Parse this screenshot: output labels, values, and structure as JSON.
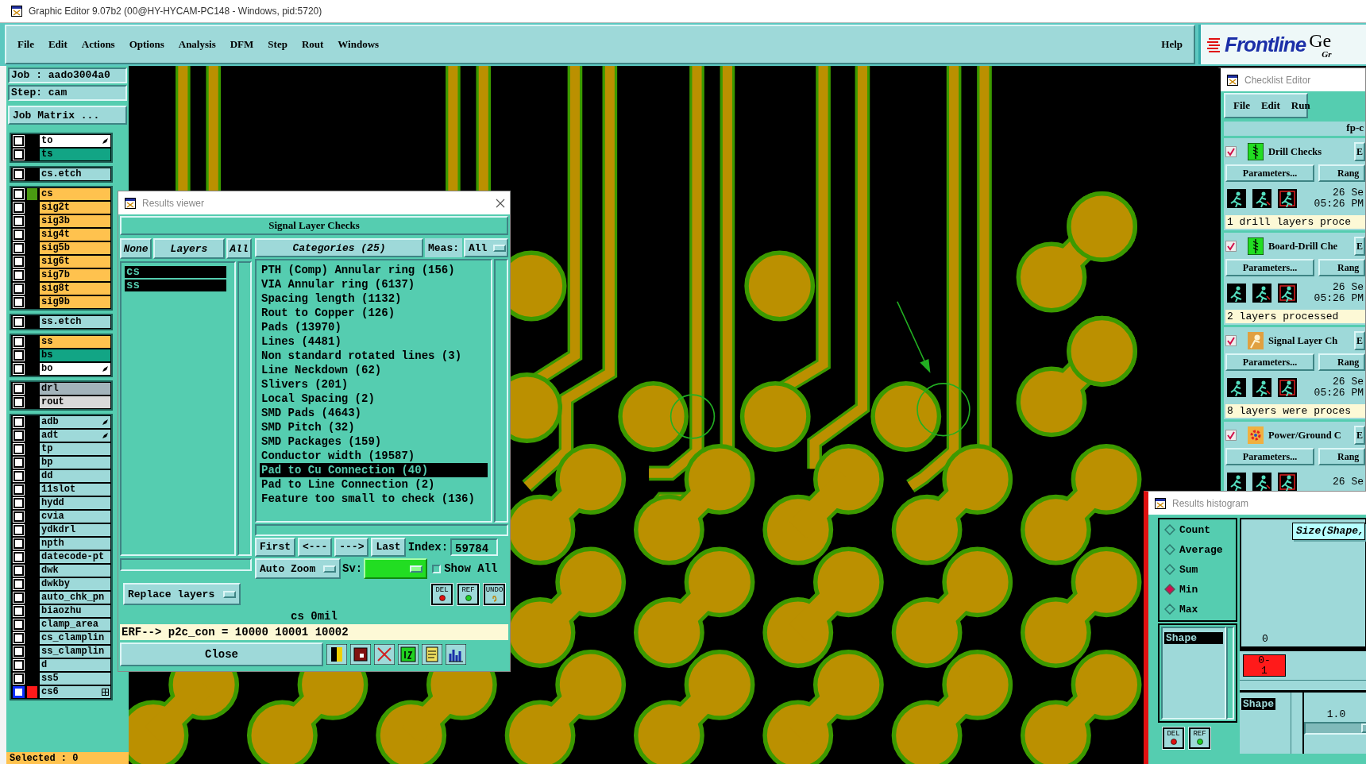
{
  "window": {
    "title": "Graphic Editor 9.07b2 (00@HY-HYCAM-PC148 - Windows, pid:5720)"
  },
  "menu": [
    "File",
    "Edit",
    "Actions",
    "Options",
    "Analysis",
    "DFM",
    "Step",
    "Rout",
    "Windows"
  ],
  "help": "Help",
  "logo": {
    "brand": "Frontline",
    "text": "Ge",
    "subtext": "Gr"
  },
  "job": {
    "job": "Job : aado3004a0",
    "step": "Step: cam",
    "matrix_button": "Job Matrix ..."
  },
  "layer_groups": [
    {
      "layers": [
        {
          "name": "to",
          "color": "#ffffff",
          "kind": "edit",
          "checked": false,
          "work": false,
          "focused": false
        },
        {
          "name": "ts",
          "color": "#12a585",
          "kind": "plain",
          "checked": false,
          "work": false,
          "focused": false
        }
      ]
    },
    {
      "layers": [
        {
          "name": "cs.etch",
          "color": "#9ed9d9",
          "kind": "plain",
          "checked": false,
          "work": false,
          "focused": false
        }
      ]
    },
    {
      "layers": [
        {
          "name": "cs",
          "color": "#ffc24e",
          "kind": "plain",
          "checked": false,
          "work": true,
          "focused": false
        },
        {
          "name": "sig2t",
          "color": "#ffc24e",
          "kind": "plain",
          "checked": false,
          "work": false,
          "focused": false
        },
        {
          "name": "sig3b",
          "color": "#ffc24e",
          "kind": "plain",
          "checked": false,
          "work": false,
          "focused": false
        },
        {
          "name": "sig4t",
          "color": "#ffc24e",
          "kind": "plain",
          "checked": false,
          "work": false,
          "focused": false
        },
        {
          "name": "sig5b",
          "color": "#ffc24e",
          "kind": "plain",
          "checked": false,
          "work": false,
          "focused": false
        },
        {
          "name": "sig6t",
          "color": "#ffc24e",
          "kind": "plain",
          "checked": false,
          "work": false,
          "focused": false
        },
        {
          "name": "sig7b",
          "color": "#ffc24e",
          "kind": "plain",
          "checked": false,
          "work": false,
          "focused": false
        },
        {
          "name": "sig8t",
          "color": "#ffc24e",
          "kind": "plain",
          "checked": false,
          "work": false,
          "focused": false
        },
        {
          "name": "sig9b",
          "color": "#ffc24e",
          "kind": "plain",
          "checked": false,
          "work": false,
          "focused": false
        }
      ]
    },
    {
      "layers": [
        {
          "name": "ss.etch",
          "color": "#9ed9d9",
          "kind": "plain",
          "checked": false,
          "work": false,
          "focused": false
        }
      ]
    },
    {
      "layers": [
        {
          "name": "ss",
          "color": "#ffc24e",
          "kind": "plain",
          "checked": false,
          "work": false,
          "focused": false
        },
        {
          "name": "bs",
          "color": "#12a585",
          "kind": "plain",
          "checked": false,
          "work": false,
          "focused": false
        },
        {
          "name": "bo",
          "color": "#ffffff",
          "kind": "edit",
          "checked": false,
          "work": false,
          "focused": false
        }
      ]
    },
    {
      "layers": [
        {
          "name": "drl",
          "color": "#a3b3bb",
          "kind": "plain",
          "checked": false,
          "work": false,
          "focused": false
        },
        {
          "name": "rout",
          "color": "#dadada",
          "kind": "plain",
          "checked": false,
          "work": false,
          "focused": false
        }
      ]
    },
    {
      "layers": [
        {
          "name": "adb",
          "color": "#9ed9d9",
          "kind": "edit",
          "checked": false,
          "work": false,
          "focused": false
        },
        {
          "name": "adt",
          "color": "#9ed9d9",
          "kind": "edit",
          "checked": false,
          "work": false,
          "focused": false
        },
        {
          "name": "tp",
          "color": "#9ed9d9",
          "kind": "plain",
          "checked": false,
          "work": false,
          "focused": false
        },
        {
          "name": "bp",
          "color": "#9ed9d9",
          "kind": "plain",
          "checked": false,
          "work": false,
          "focused": false
        },
        {
          "name": "dd",
          "color": "#9ed9d9",
          "kind": "plain",
          "checked": false,
          "work": false,
          "focused": false
        },
        {
          "name": "11slot",
          "color": "#9ed9d9",
          "kind": "plain",
          "checked": false,
          "work": false,
          "focused": false
        },
        {
          "name": "hydd",
          "color": "#9ed9d9",
          "kind": "plain",
          "checked": false,
          "work": false,
          "focused": false
        },
        {
          "name": "cvia",
          "color": "#9ed9d9",
          "kind": "plain",
          "checked": false,
          "work": false,
          "focused": false
        },
        {
          "name": "ydkdrl",
          "color": "#9ed9d9",
          "kind": "plain",
          "checked": false,
          "work": false,
          "focused": false
        },
        {
          "name": "npth",
          "color": "#9ed9d9",
          "kind": "plain",
          "checked": false,
          "work": false,
          "focused": false
        },
        {
          "name": "datecode-pt",
          "color": "#9ed9d9",
          "kind": "plain",
          "checked": false,
          "work": false,
          "focused": false
        },
        {
          "name": "dwk",
          "color": "#9ed9d9",
          "kind": "plain",
          "checked": false,
          "work": false,
          "focused": false
        },
        {
          "name": "dwkby",
          "color": "#9ed9d9",
          "kind": "plain",
          "checked": false,
          "work": false,
          "focused": false
        },
        {
          "name": "auto_chk_pn",
          "color": "#9ed9d9",
          "kind": "plain",
          "checked": false,
          "work": false,
          "focused": false
        },
        {
          "name": "biaozhu",
          "color": "#9ed9d9",
          "kind": "plain",
          "checked": false,
          "work": false,
          "focused": false
        },
        {
          "name": "clamp_area",
          "color": "#9ed9d9",
          "kind": "plain",
          "checked": false,
          "work": false,
          "focused": false
        },
        {
          "name": "cs_clamplin",
          "color": "#9ed9d9",
          "kind": "plain",
          "checked": false,
          "work": false,
          "focused": false
        },
        {
          "name": "ss_clamplin",
          "color": "#9ed9d9",
          "kind": "plain",
          "checked": false,
          "work": false,
          "focused": false
        },
        {
          "name": "d",
          "color": "#9ed9d9",
          "kind": "plain",
          "checked": false,
          "work": false,
          "focused": false
        },
        {
          "name": "ss5",
          "color": "#9ed9d9",
          "kind": "plain",
          "checked": false,
          "work": false,
          "focused": false
        },
        {
          "name": "cs6",
          "color": "#9ed9d9",
          "kind": "grid",
          "checked": false,
          "work": false,
          "focused": true
        }
      ]
    }
  ],
  "selected_status": "Selected : 0",
  "results_viewer": {
    "title": "Results viewer",
    "heading": "Signal Layer Checks",
    "none_button": "None",
    "layers_label": "Layers",
    "all_button": "All",
    "layers": [
      {
        "name": "cs",
        "selected": true
      },
      {
        "name": "ss",
        "selected": true
      }
    ],
    "categories_button": "Categories (25)",
    "meas_label": "Meas:",
    "meas_value": "All",
    "categories": [
      {
        "label": "PTH (Comp) Annular ring (156)",
        "selected": false
      },
      {
        "label": "VIA Annular ring (6137)",
        "selected": false
      },
      {
        "label": "Spacing length (1132)",
        "selected": false
      },
      {
        "label": "Rout to Copper (126)",
        "selected": false
      },
      {
        "label": "Pads (13970)",
        "selected": false
      },
      {
        "label": "Lines (4481)",
        "selected": false
      },
      {
        "label": "Non standard rotated lines (3)",
        "selected": false
      },
      {
        "label": "Line Neckdown (62)",
        "selected": false
      },
      {
        "label": "Slivers (201)",
        "selected": false
      },
      {
        "label": "Local Spacing (2)",
        "selected": false
      },
      {
        "label": "SMD Pads (4643)",
        "selected": false
      },
      {
        "label": "SMD Pitch (32)",
        "selected": false
      },
      {
        "label": "SMD Packages (159)",
        "selected": false
      },
      {
        "label": "Conductor width (19587)",
        "selected": false
      },
      {
        "label": "Pad to Cu Connection (40)",
        "selected": true
      },
      {
        "label": "Pad to Line Connection (2)",
        "selected": false
      },
      {
        "label": "Feature too small to check (136)",
        "selected": false
      }
    ],
    "nav": [
      "First",
      "<---",
      "--->",
      "Last"
    ],
    "index_label": "Index:",
    "index_value": "59784",
    "zoom_mode": "Auto Zoom",
    "sv_label": "Sv:",
    "show_all": {
      "label": "Show All",
      "checked": false
    },
    "replace_mode": "Replace layers",
    "action_buttons": [
      {
        "label": "DEL",
        "kind": "del"
      },
      {
        "label": "REF",
        "kind": "ref"
      },
      {
        "label": "UNDO",
        "kind": "undo"
      }
    ],
    "status": "cs 0mil",
    "erf": "ERF--> p2c_con = 10000 10001 10002",
    "close": "Close"
  },
  "checklist_editor": {
    "title": "Checklist Editor",
    "menu": [
      "File",
      "Edit",
      "Run"
    ],
    "checklist_name": "fp-c",
    "checks": [
      {
        "name": "Drill Checks",
        "kind": "drill",
        "checked": true,
        "erf": "E",
        "parameters": "Parameters...",
        "ranges": "Rang",
        "date": "26 Se",
        "time": "05:26 PM",
        "status": "1 drill layers proce"
      },
      {
        "name": "Board-Drill Che",
        "kind": "drill",
        "checked": true,
        "erf": "E",
        "parameters": "Parameters...",
        "ranges": "Rang",
        "date": "26 Se",
        "time": "05:26 PM",
        "status": "2 layers processed"
      },
      {
        "name": "Signal Layer Ch",
        "kind": "signal",
        "checked": true,
        "erf": "E",
        "parameters": "Parameters...",
        "ranges": "Rang",
        "date": "26 Se",
        "time": "05:26 PM",
        "status": "8 layers were proces"
      },
      {
        "name": "Power/Ground C",
        "kind": "power",
        "checked": true,
        "erf": "E",
        "parameters": "Parameters...",
        "ranges": "Rang",
        "date": "26 Se"
      }
    ]
  },
  "histogram": {
    "title": "Results histogram",
    "modes": [
      {
        "label": "Count",
        "selected": false
      },
      {
        "label": "Average",
        "selected": false
      },
      {
        "label": "Sum",
        "selected": false
      },
      {
        "label": "Min",
        "selected": true
      },
      {
        "label": "Max",
        "selected": false
      }
    ],
    "fields": [
      {
        "name": "Shape",
        "selected": true
      }
    ],
    "buttons": [
      {
        "label": "DEL",
        "kind": "del"
      },
      {
        "label": "REF",
        "kind": "ref"
      }
    ],
    "chart_title": "Size(Shape,",
    "bar_value": "0",
    "bin": "0-1",
    "groups": [
      {
        "name": "Shape",
        "selected": true
      }
    ],
    "scale": "1.0"
  }
}
